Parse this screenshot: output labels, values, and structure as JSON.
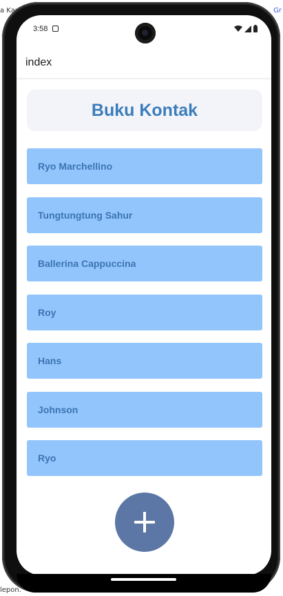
{
  "desktop": {
    "top_left_text": "a Kari",
    "top_right_text": "Gr",
    "bottom_text": "lepon."
  },
  "status_bar": {
    "time": "3:58",
    "icons": [
      "notification-icon",
      "wifi-icon",
      "signal-icon",
      "battery-icon"
    ]
  },
  "app_bar": {
    "title": "index"
  },
  "main": {
    "title": "Buku Kontak",
    "contacts": [
      {
        "name": "Ryo Marchellino"
      },
      {
        "name": "Tungtungtung Sahur"
      },
      {
        "name": "Ballerina Cappuccina"
      },
      {
        "name": "Roy"
      },
      {
        "name": "Hans"
      },
      {
        "name": "Johnson"
      },
      {
        "name": "Ryo"
      }
    ],
    "fab": {
      "icon": "plus-icon"
    }
  },
  "colors": {
    "title_text": "#3b7dbc",
    "title_card_bg": "#f3f4f9",
    "contact_bg": "#93c5fd",
    "contact_text": "#3b74b2",
    "fab_bg": "#5c77a6"
  }
}
